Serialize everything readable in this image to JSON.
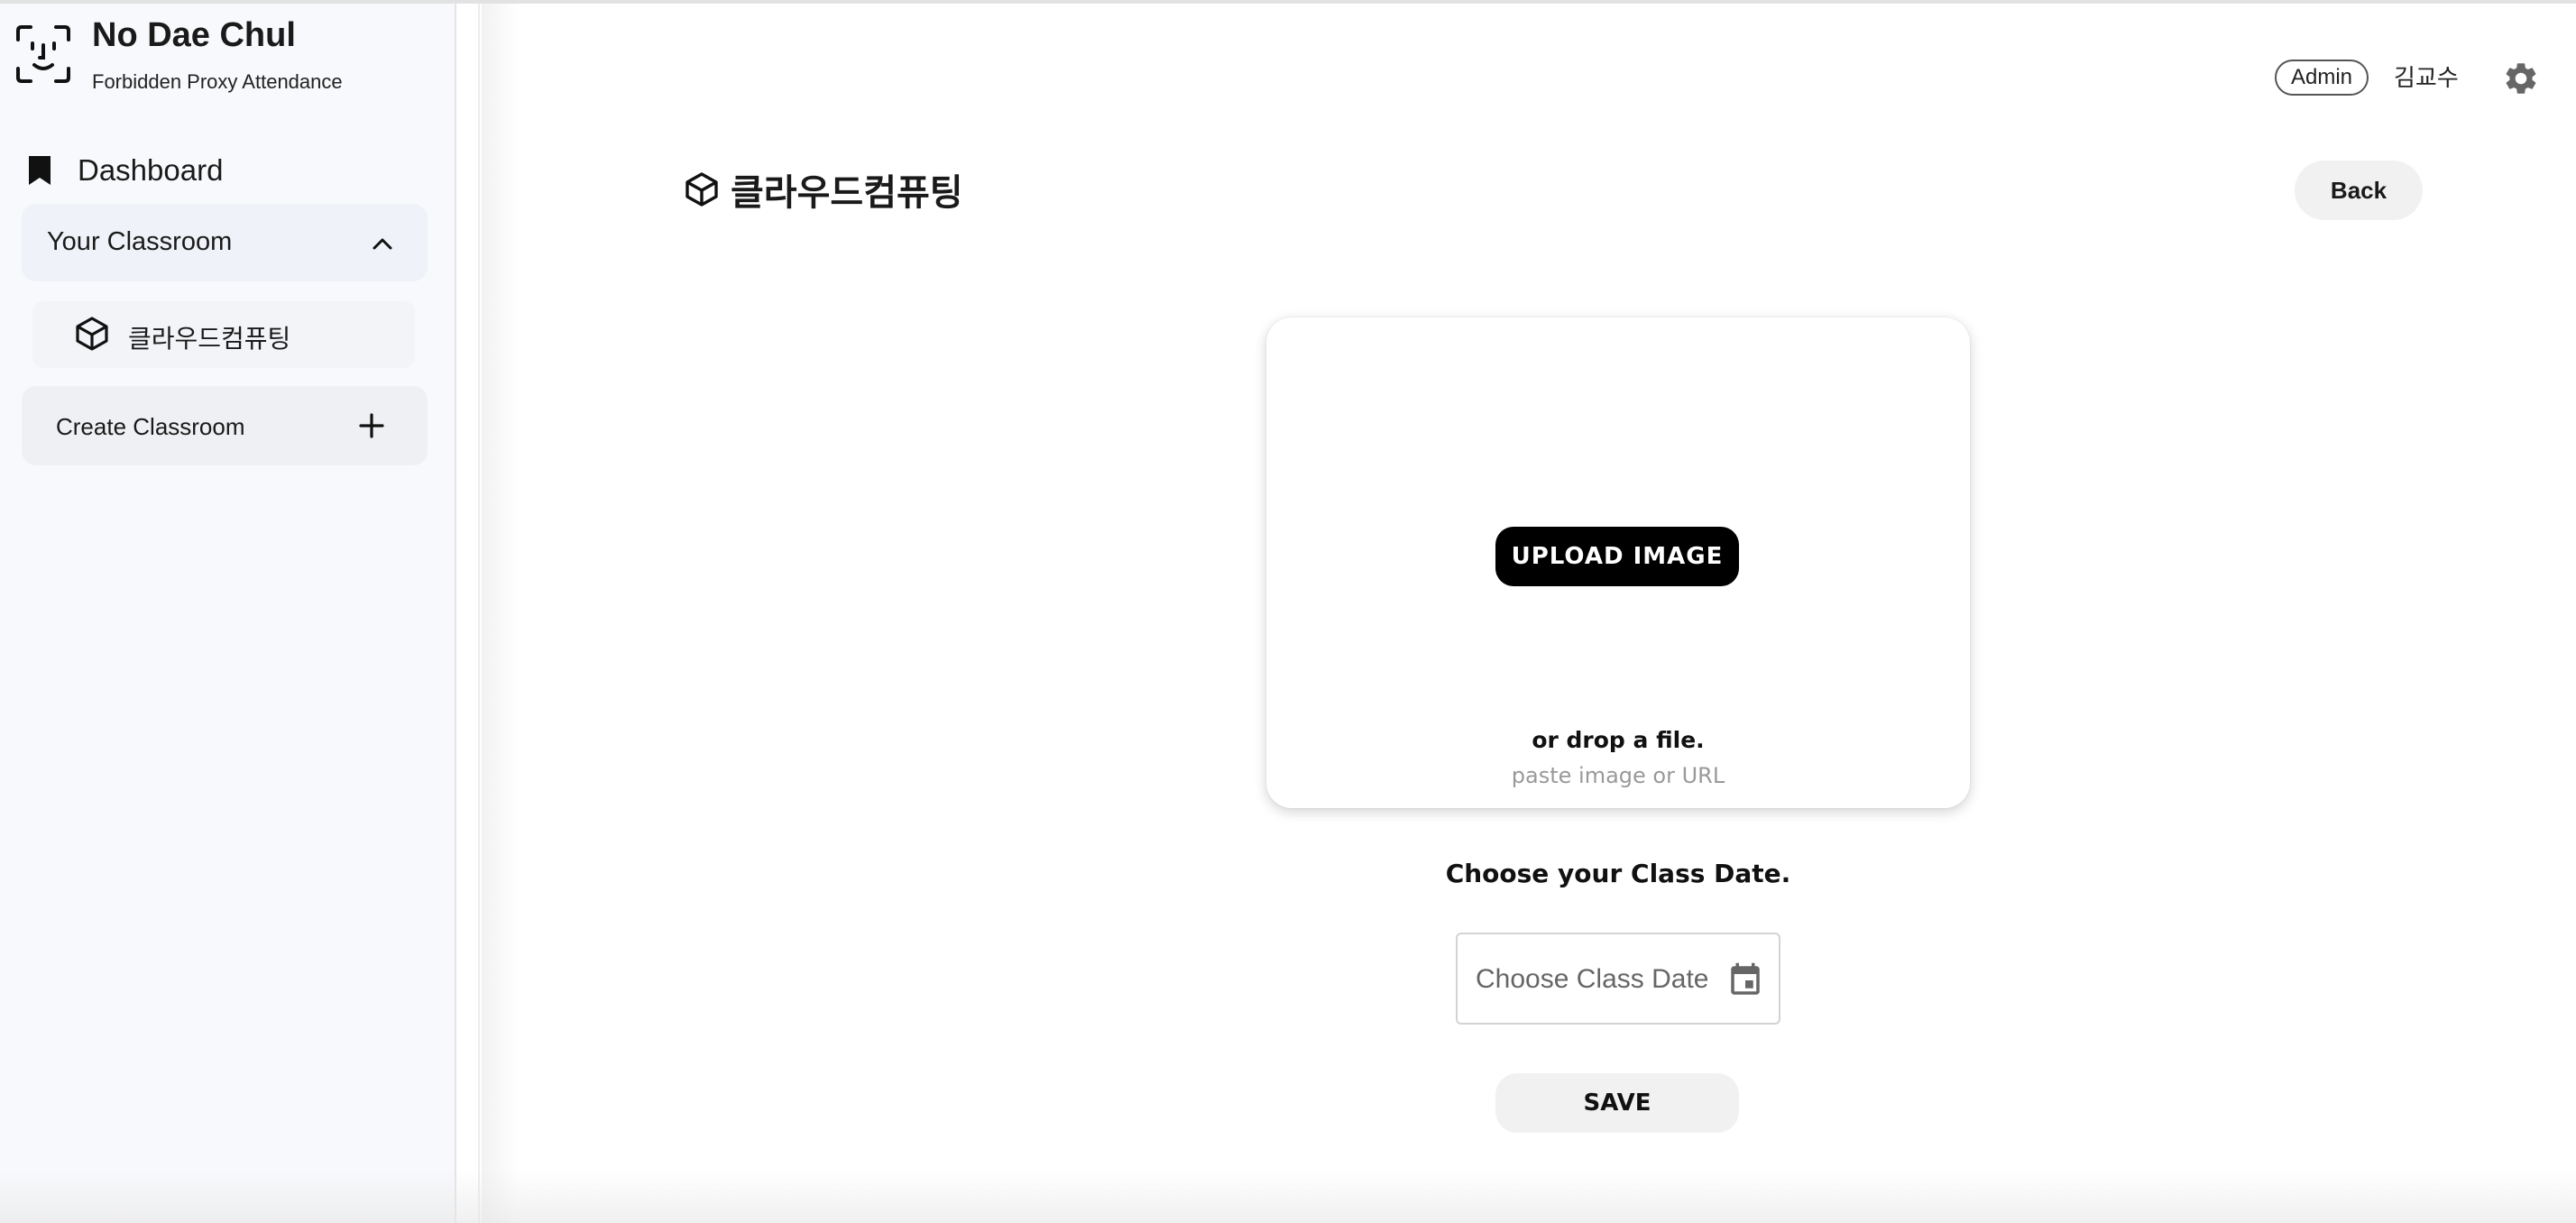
{
  "brand": {
    "title": "No Dae Chul",
    "subtitle": "Forbidden Proxy Attendance",
    "icon": "face-scan-icon"
  },
  "sidebar": {
    "dashboard_label": "Dashboard",
    "classroom_section_label": "Your Classroom",
    "classrooms": [
      {
        "label": "클라우드컴퓨팅",
        "icon": "cube-icon"
      }
    ],
    "create_label": "Create Classroom"
  },
  "header": {
    "role_badge": "Admin",
    "username": "김교수"
  },
  "page": {
    "title": "클라우드컴퓨팅",
    "back_label": "Back"
  },
  "upload": {
    "button_label": "UPLOAD IMAGE",
    "drop_text": "or drop a file.",
    "paste_text": "paste image or URL"
  },
  "date": {
    "label": "Choose your Class Date.",
    "placeholder": "Choose Class Date"
  },
  "save_label": "SAVE"
}
